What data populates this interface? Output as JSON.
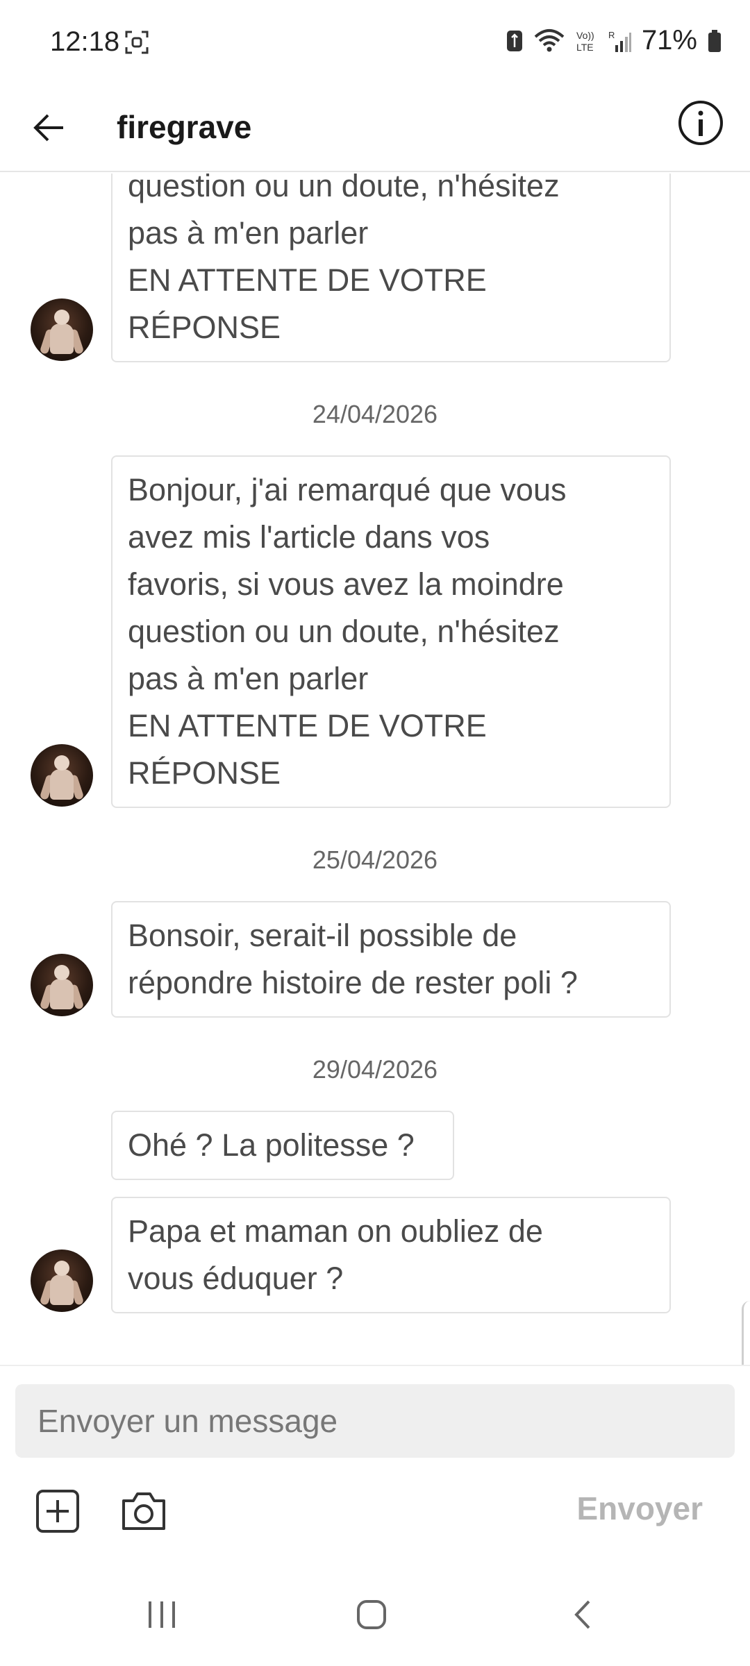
{
  "status_bar": {
    "time": "12:18",
    "battery": "71%",
    "icons": [
      "screenshot-icon",
      "data-icon",
      "wifi-icon",
      "volte-icon",
      "signal-icon",
      "battery-icon"
    ]
  },
  "header": {
    "title": "firegrave",
    "back_icon": "arrow-left-icon",
    "info_icon": "info-icon"
  },
  "messages": [
    {
      "type": "bubble",
      "has_avatar": true,
      "text": "favoris, si vous avez la moindre\nquestion ou un doute, n'hésitez\npas à m'en parler\nEN ATTENTE DE VOTRE\nRÉPONSE"
    },
    {
      "type": "date",
      "text": "24/04/2026"
    },
    {
      "type": "bubble",
      "has_avatar": true,
      "text": "Bonjour, j'ai remarqué que vous\navez mis l'article dans vos\nfavoris, si vous avez la moindre\nquestion ou un doute, n'hésitez\npas à m'en parler\nEN ATTENTE DE VOTRE\nRÉPONSE"
    },
    {
      "type": "date",
      "text": "25/04/2026"
    },
    {
      "type": "bubble",
      "has_avatar": true,
      "text": "Bonsoir, serait-il possible de\nrépondre histoire de rester poli ?"
    },
    {
      "type": "date",
      "text": "29/04/2026"
    },
    {
      "type": "bubble",
      "has_avatar": false,
      "text": "Ohé ? La politesse ?"
    },
    {
      "type": "bubble",
      "has_avatar": true,
      "text": "Papa et maman on oubliez de\nvous éduquer ?"
    }
  ],
  "composer": {
    "placeholder": "Envoyer un message",
    "send_label": "Envoyer",
    "add_icon": "plus-square-icon",
    "camera_icon": "camera-icon"
  },
  "navbar": {
    "icons": [
      "recent-apps-icon",
      "home-icon",
      "back-icon"
    ]
  }
}
